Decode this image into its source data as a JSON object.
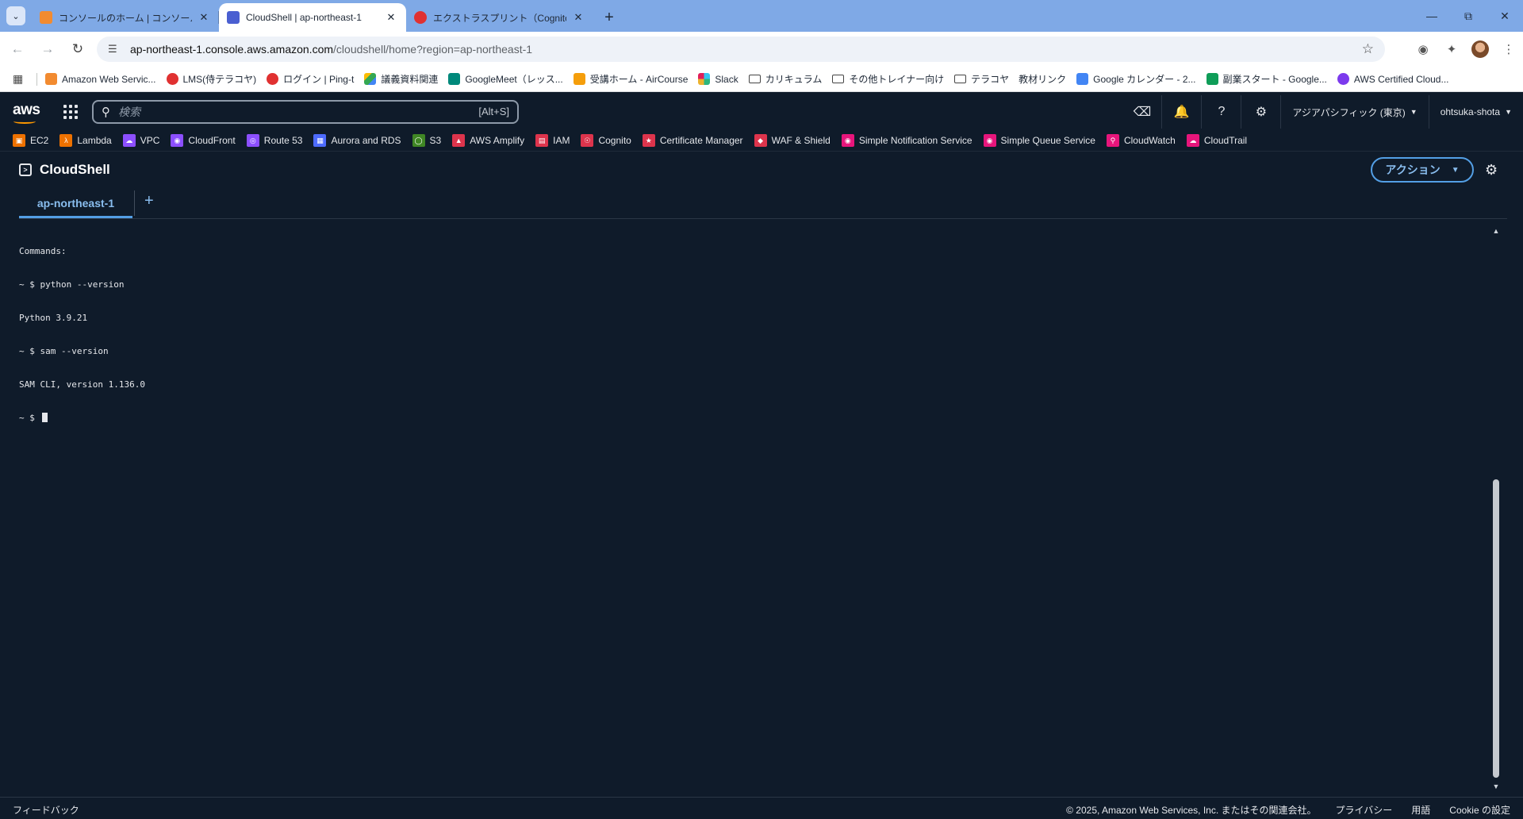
{
  "browser": {
    "tabs": [
      {
        "label": "コンソールのホーム | コンソールのホーム",
        "favicon": "aws-console-icon",
        "color": "#f28b30",
        "active": false
      },
      {
        "label": "CloudShell | ap-northeast-1",
        "favicon": "cloudshell-icon",
        "color": "#4a5fd1",
        "active": true
      },
      {
        "label": "エクストラスプリント（Cognito）| コ",
        "favicon": "red-swirl-icon",
        "color": "#e03131",
        "active": false
      }
    ],
    "url_host": "ap-northeast-1.console.aws.amazon.com",
    "url_path": "/cloudshell/home?region=ap-northeast-1",
    "bookmarks": [
      {
        "label": "Amazon Web Servic...",
        "icon": "aws-cube-icon",
        "color": "#f28b30"
      },
      {
        "label": "LMS(侍テラコヤ)",
        "icon": "red-swirl-icon",
        "color": "#e03131"
      },
      {
        "label": "ログイン | Ping-t",
        "icon": "ping-t-icon",
        "color": "#e03131"
      },
      {
        "label": "議義資料関連",
        "icon": "google-drive-icon",
        "color": "#34a853"
      },
      {
        "label": "GoogleMeet（レッス...",
        "icon": "google-meet-icon",
        "color": "#00897b"
      },
      {
        "label": "受講ホーム - AirCourse",
        "icon": "aircourse-icon",
        "color": "#f59e0b"
      },
      {
        "label": "Slack",
        "icon": "slack-icon",
        "color": "#611f69"
      },
      {
        "label": "カリキュラム",
        "icon": "folder-icon",
        "color": ""
      },
      {
        "label": "その他トレイナー向け",
        "icon": "folder-icon",
        "color": ""
      },
      {
        "label": "テラコヤ　教材リンク",
        "icon": "folder-icon",
        "color": ""
      },
      {
        "label": "Google カレンダー - 2...",
        "icon": "google-calendar-icon",
        "color": "#4285f4"
      },
      {
        "label": "副業スタート - Google...",
        "icon": "google-sheets-icon",
        "color": "#0f9d58"
      },
      {
        "label": "AWS Certified Cloud...",
        "icon": "aws-cert-icon",
        "color": "#7c3aed"
      }
    ]
  },
  "aws": {
    "logo": "aws",
    "search_placeholder": "検索",
    "search_shortcut": "[Alt+S]",
    "region": "アジアパシフィック (東京)",
    "user": "ohtsuka-shota",
    "favorites": [
      {
        "label": "EC2",
        "icon": "ec2-icon",
        "color": "#ed7100"
      },
      {
        "label": "Lambda",
        "icon": "lambda-icon",
        "color": "#ed7100"
      },
      {
        "label": "VPC",
        "icon": "vpc-icon",
        "color": "#8c4fff"
      },
      {
        "label": "CloudFront",
        "icon": "cloudfront-icon",
        "color": "#8c4fff"
      },
      {
        "label": "Route 53",
        "icon": "route53-icon",
        "color": "#8c4fff"
      },
      {
        "label": "Aurora and RDS",
        "icon": "rds-icon",
        "color": "#4d6bfe"
      },
      {
        "label": "S3",
        "icon": "s3-icon",
        "color": "#3f8624"
      },
      {
        "label": "AWS Amplify",
        "icon": "amplify-icon",
        "color": "#dd344c"
      },
      {
        "label": "IAM",
        "icon": "iam-icon",
        "color": "#dd344c"
      },
      {
        "label": "Cognito",
        "icon": "cognito-icon",
        "color": "#dd344c"
      },
      {
        "label": "Certificate Manager",
        "icon": "certificate-manager-icon",
        "color": "#dd344c"
      },
      {
        "label": "WAF & Shield",
        "icon": "waf-icon",
        "color": "#dd344c"
      },
      {
        "label": "Simple Notification Service",
        "icon": "sns-icon",
        "color": "#e7157b"
      },
      {
        "label": "Simple Queue Service",
        "icon": "sqs-icon",
        "color": "#e7157b"
      },
      {
        "label": "CloudWatch",
        "icon": "cloudwatch-icon",
        "color": "#e7157b"
      },
      {
        "label": "CloudTrail",
        "icon": "cloudtrail-icon",
        "color": "#e7157b"
      }
    ]
  },
  "cloudshell": {
    "title": "CloudShell",
    "action_label": "アクション",
    "session_tab": "ap-northeast-1",
    "terminal_lines": [
      "Commands:",
      "~ $ python --version",
      "Python 3.9.21",
      "~ $ sam --version",
      "SAM CLI, version 1.136.0"
    ],
    "prompt": "~ $ "
  },
  "footer": {
    "feedback": "フィードバック",
    "copyright": "© 2025, Amazon Web Services, Inc. またはその関連会社。",
    "privacy": "プライバシー",
    "terms": "用語",
    "cookie": "Cookie の設定"
  }
}
